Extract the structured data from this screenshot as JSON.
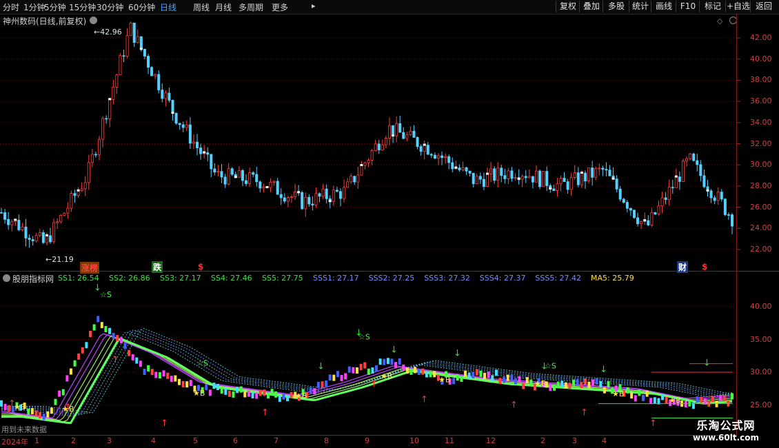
{
  "toolbar": {
    "timeframes": [
      "分时",
      "1分钟",
      "5分钟",
      "15分钟",
      "30分钟",
      "60分钟",
      "日线",
      "周线",
      "月线",
      "多周期",
      "更多"
    ],
    "active": "日线",
    "buttons": [
      "复权",
      "叠加",
      "多股",
      "统计",
      "画线",
      "F10",
      "标记",
      "+自选",
      "返回"
    ]
  },
  "main": {
    "stock_title": "神州数码(日线,前复权)",
    "high_label": "42.96",
    "low_label": "21.19",
    "y_ticks": [
      "42.00",
      "40.00",
      "38.00",
      "36.00",
      "34.00",
      "32.00",
      "30.00",
      "28.00",
      "26.00",
      "24.00",
      "22.00"
    ],
    "markers": {
      "up_list": "涨榜",
      "down": "跌",
      "dollar": "$",
      "finance": "财",
      "dollar2": "$"
    }
  },
  "indicator": {
    "name": "股朋指标网",
    "values": [
      {
        "label": "SS1: 26.54",
        "color": "#40e040"
      },
      {
        "label": "SS2: 26.86",
        "color": "#40e040"
      },
      {
        "label": "SS3: 27.17",
        "color": "#40e040"
      },
      {
        "label": "SS4: 27.46",
        "color": "#40e040"
      },
      {
        "label": "SS5: 27.75",
        "color": "#40e040"
      },
      {
        "label": "SSS1: 27.17",
        "color": "#7a8cff"
      },
      {
        "label": "SSS2: 27.25",
        "color": "#7a8cff"
      },
      {
        "label": "SSS3: 27.32",
        "color": "#7a8cff"
      },
      {
        "label": "SSS4: 27.37",
        "color": "#7a8cff"
      },
      {
        "label": "SSS5: 27.42",
        "color": "#7a8cff"
      },
      {
        "label": "MA5: 25.79",
        "color": "#ffe040"
      }
    ],
    "y_ticks": [
      "40.00",
      "35.00",
      "30.00",
      "25.00"
    ],
    "bottom_note": "用到未来数据"
  },
  "x_axis": {
    "labels": [
      "2024年",
      "1",
      "2",
      "3",
      "4",
      "5",
      "6",
      "7",
      "8",
      "9",
      "10",
      "11",
      "12",
      "2",
      "3",
      "4"
    ]
  },
  "watermark": {
    "line1": "乐淘公式网",
    "line2": "www.60lt.com"
  },
  "chart_data": [
    {
      "type": "line",
      "title": "神州数码(日线,前复权)",
      "ylim": [
        21,
        43
      ],
      "x": [
        "2024-01",
        "2024-02",
        "2024-02",
        "2024-03",
        "2024-04",
        "2024-05",
        "2024-06",
        "2024-07",
        "2024-08",
        "2024-09",
        "2024-10",
        "2024-11",
        "2024-12",
        "2025-01",
        "2025-02",
        "2025-03",
        "2025-04",
        "2025-04"
      ],
      "series": [
        {
          "values": [
            25.5,
            22.5,
            29.0,
            42.96,
            35.0,
            29.0,
            28.5,
            26.5,
            27.5,
            33.5,
            31.5,
            28.5,
            29.5,
            28.0,
            29.5,
            24.0,
            30.5,
            25.0
          ]
        }
      ],
      "annotations": [
        "42.96",
        "21.19"
      ]
    },
    {
      "type": "line",
      "ylim": [
        20,
        44
      ],
      "x": [
        "2024-01",
        "2024-02",
        "2024-03",
        "2024-04",
        "2024-05",
        "2024-06",
        "2024-07",
        "2024-08",
        "2024-09",
        "2024-10",
        "2024-11",
        "2024-12",
        "2025-01",
        "2025-02",
        "2025-03",
        "2025-04"
      ],
      "series": [
        {
          "name": "SS1",
          "values": [
            24.0,
            23.0,
            36.0,
            33.0,
            28.5,
            27.5,
            26.5,
            28.5,
            31.0,
            30.0,
            29.0,
            28.5,
            28.0,
            27.5,
            26.0,
            26.54
          ]
        },
        {
          "name": "MA5",
          "values": [
            25.0,
            23.5,
            38.0,
            30.0,
            27.5,
            27.0,
            26.0,
            29.5,
            31.5,
            29.0,
            29.5,
            28.0,
            28.5,
            26.5,
            25.0,
            25.79
          ]
        }
      ]
    }
  ]
}
